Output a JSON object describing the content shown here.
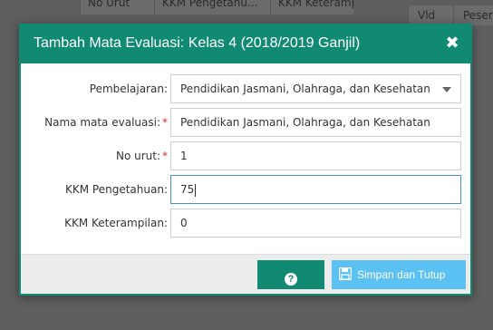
{
  "background": {
    "table_headers": [
      "No Urut",
      "KKM Pengetahu...",
      "KKM Keteramp"
    ],
    "right_headers": [
      "Vld",
      "Peserta"
    ]
  },
  "dialog": {
    "title": "Tambah Mata Evaluasi: Kelas 4 (2018/2019 Ganjil)",
    "close_icon": "close-icon",
    "fields": [
      {
        "label": "Pembelajaran:",
        "required": false,
        "value": "Pendidikan Jasmani, Olahraga, dan Kesehatan",
        "type": "select"
      },
      {
        "label": "Nama mata evaluasi:",
        "required": true,
        "value": "Pendidikan Jasmani, Olahraga, dan Kesehatan",
        "type": "text"
      },
      {
        "label": "No urut:",
        "required": true,
        "value": "1",
        "type": "text"
      },
      {
        "label": "KKM Pengetahuan:",
        "required": false,
        "value": "75",
        "type": "text"
      },
      {
        "label": "KKM Keterampilan:",
        "required": false,
        "value": "0",
        "type": "text"
      }
    ],
    "required_mark": "*",
    "footer": {
      "help_icon": "question-circle-icon",
      "save_icon": "floppy-disk-icon",
      "save_label": "Simpan dan Tutup"
    }
  },
  "colors": {
    "primary": "#118a74",
    "save_button": "#5bc0f2",
    "overlay": "#5e5e5e"
  }
}
